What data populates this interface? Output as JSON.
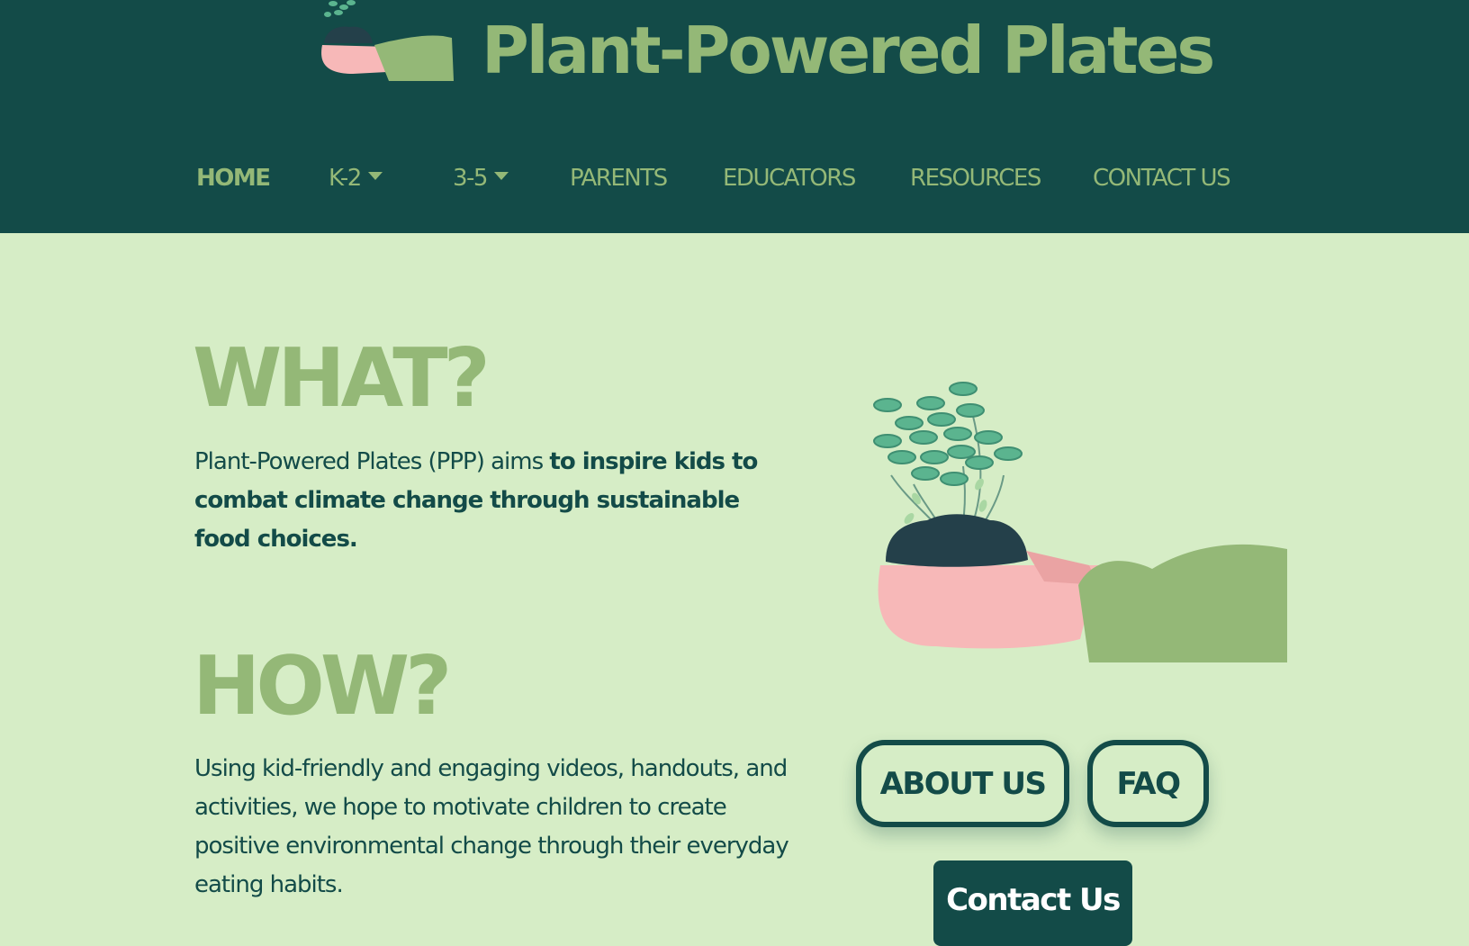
{
  "brand": {
    "title": "Plant-Powered Plates",
    "logo_icon": "hand-holding-plant-logo"
  },
  "nav": {
    "items": [
      {
        "label": "HOME",
        "active": true
      },
      {
        "label": "K-2",
        "dropdown": true
      },
      {
        "label": "3-5",
        "dropdown": true
      },
      {
        "label": "PARENTS"
      },
      {
        "label": "EDUCATORS"
      },
      {
        "label": "RESOURCES"
      },
      {
        "label": "CONTACT US"
      }
    ]
  },
  "what": {
    "heading": "WHAT?",
    "text_plain": "Plant-Powered Plates (PPP) aims ",
    "text_bold": "to inspire kids to combat climate change through sustainable food choices."
  },
  "how": {
    "heading": "HOW?",
    "text": "Using kid-friendly and engaging videos, handouts, and activities, we hope to motivate children to create positive environmental change through their everyday eating habits."
  },
  "hero": {
    "icon": "hand-holding-plant-illustration"
  },
  "buttons": {
    "about": "ABOUT US",
    "faq": "FAQ",
    "contact": "Contact Us"
  },
  "colors": {
    "header_bg": "#134b48",
    "page_bg": "#d6edc6",
    "accent_green": "#94b877",
    "skin_pink": "#f7b8b8",
    "soil": "#24404a",
    "leaf": "#5bb48f"
  }
}
